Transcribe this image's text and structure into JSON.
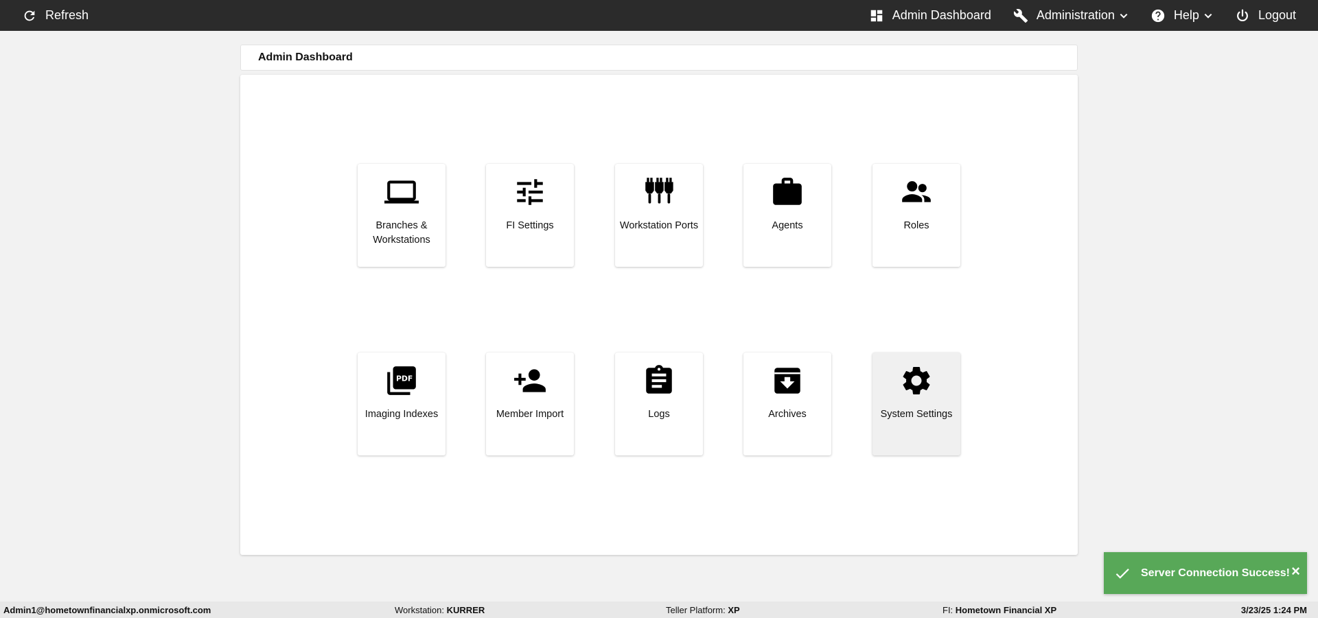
{
  "topbar": {
    "refresh_label": "Refresh",
    "nav": {
      "dashboard_label": "Admin Dashboard",
      "administration_label": "Administration",
      "help_label": "Help",
      "logout_label": "Logout"
    }
  },
  "page": {
    "title": "Admin Dashboard"
  },
  "tiles": [
    {
      "label": "Branches & Workstations",
      "icon": "laptop-icon"
    },
    {
      "label": "FI Settings",
      "icon": "sliders-icon"
    },
    {
      "label": "Workstation Ports",
      "icon": "ports-icon"
    },
    {
      "label": "Agents",
      "icon": "briefcase-icon"
    },
    {
      "label": "Roles",
      "icon": "people-icon"
    },
    {
      "label": "Imaging Indexes",
      "icon": "pdf-icon"
    },
    {
      "label": "Member Import",
      "icon": "person-add-icon"
    },
    {
      "label": "Logs",
      "icon": "clipboard-icon"
    },
    {
      "label": "Archives",
      "icon": "archive-icon"
    },
    {
      "label": "System Settings",
      "icon": "gear-icon"
    }
  ],
  "toast": {
    "message": "Server Connection Success!",
    "close_label": "×",
    "color": "#58a858"
  },
  "statusbar": {
    "user": "Admin1@hometownfinancialxp.onmicrosoft.com",
    "workstation_label": "Workstation:",
    "workstation_value": "KURRER",
    "platform_label": "Teller Platform:",
    "platform_value": "XP",
    "fi_label": "FI:",
    "fi_value": "Hometown Financial XP",
    "datetime": "3/23/25 1:24 PM"
  }
}
